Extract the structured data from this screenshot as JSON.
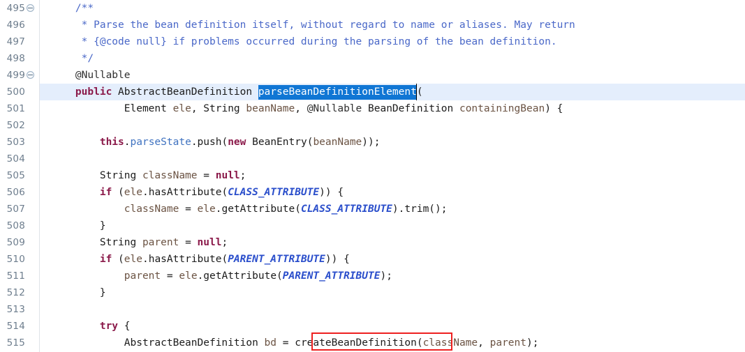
{
  "editor": {
    "kind": "java-source-editor",
    "current_line": 500,
    "selection_text": "parseBeanDefinitionElement",
    "annotation_box_text": "createBeanDefinition",
    "colors": {
      "background": "#ffffff",
      "current_line_highlight": "#e4eefc",
      "selection_background": "#1076d4",
      "selection_foreground": "#ffffff",
      "annotation_box_border": "#ee2020",
      "gutter_line_number": "#6d7d8d",
      "gutter_separator": "#dfe3e8",
      "keyword": "#8b1a4a",
      "javadoc": "#4a68c8",
      "field": "#3f72c0",
      "static_final_field": "#2a4ecb",
      "local_variable": "#6b5343",
      "plain_text": "#1b1b1b"
    }
  },
  "gutter": {
    "rows": [
      {
        "number": "495",
        "fold": true
      },
      {
        "number": "496",
        "fold": false
      },
      {
        "number": "497",
        "fold": false
      },
      {
        "number": "498",
        "fold": false
      },
      {
        "number": "499",
        "fold": true
      },
      {
        "number": "500",
        "fold": false
      },
      {
        "number": "501",
        "fold": false
      },
      {
        "number": "502",
        "fold": false
      },
      {
        "number": "503",
        "fold": false
      },
      {
        "number": "504",
        "fold": false
      },
      {
        "number": "505",
        "fold": false
      },
      {
        "number": "506",
        "fold": false
      },
      {
        "number": "507",
        "fold": false
      },
      {
        "number": "508",
        "fold": false
      },
      {
        "number": "509",
        "fold": false
      },
      {
        "number": "510",
        "fold": false
      },
      {
        "number": "511",
        "fold": false
      },
      {
        "number": "512",
        "fold": false
      },
      {
        "number": "513",
        "fold": false
      },
      {
        "number": "514",
        "fold": false
      },
      {
        "number": "515",
        "fold": false
      }
    ]
  },
  "code": {
    "lines": [
      {
        "number": "495",
        "plain": "    /**",
        "tokens": [
          {
            "t": "    /**",
            "c": "doc"
          }
        ]
      },
      {
        "number": "496",
        "plain": "     * Parse the bean definition itself, without regard to name or aliases. May return",
        "tokens": [
          {
            "t": "     * Parse the bean definition itself, without regard to name or aliases. May return",
            "c": "doc"
          }
        ]
      },
      {
        "number": "497",
        "plain": "     * {@code null} if problems occurred during the parsing of the bean definition.",
        "tokens": [
          {
            "t": "     * {@code null} if problems occurred during the parsing of the bean definition.",
            "c": "doc"
          }
        ]
      },
      {
        "number": "498",
        "plain": "     */",
        "tokens": [
          {
            "t": "     */",
            "c": "doc"
          }
        ]
      },
      {
        "number": "499",
        "plain": "    @Nullable",
        "tokens": [
          {
            "t": "    @Nullable",
            "c": "ann"
          }
        ]
      },
      {
        "number": "500",
        "plain": "    public AbstractBeanDefinition parseBeanDefinitionElement(",
        "tokens": [
          {
            "t": "    ",
            "c": "pl"
          },
          {
            "t": "public",
            "c": "kw"
          },
          {
            "t": " AbstractBeanDefinition ",
            "c": "pl"
          },
          {
            "t": "parseBeanDefinitionElement",
            "c": "sel"
          },
          {
            "t": "(",
            "c": "pl"
          }
        ]
      },
      {
        "number": "501",
        "plain": "            Element ele, String beanName, @Nullable BeanDefinition containingBean) {",
        "tokens": [
          {
            "t": "            Element ",
            "c": "pl"
          },
          {
            "t": "ele",
            "c": "lv"
          },
          {
            "t": ", String ",
            "c": "pl"
          },
          {
            "t": "beanName",
            "c": "lv"
          },
          {
            "t": ", ",
            "c": "pl"
          },
          {
            "t": "@Nullable",
            "c": "ann"
          },
          {
            "t": " BeanDefinition ",
            "c": "pl"
          },
          {
            "t": "containingBean",
            "c": "lv"
          },
          {
            "t": ") {",
            "c": "pl"
          }
        ]
      },
      {
        "number": "502",
        "plain": "",
        "tokens": []
      },
      {
        "number": "503",
        "plain": "        this.parseState.push(new BeanEntry(beanName));",
        "tokens": [
          {
            "t": "        ",
            "c": "pl"
          },
          {
            "t": "this",
            "c": "kw"
          },
          {
            "t": ".",
            "c": "pl"
          },
          {
            "t": "parseState",
            "c": "fld"
          },
          {
            "t": ".push(",
            "c": "pl"
          },
          {
            "t": "new",
            "c": "kw"
          },
          {
            "t": " BeanEntry(",
            "c": "pl"
          },
          {
            "t": "beanName",
            "c": "lv"
          },
          {
            "t": "));",
            "c": "pl"
          }
        ]
      },
      {
        "number": "504",
        "plain": "",
        "tokens": []
      },
      {
        "number": "505",
        "plain": "        String className = null;",
        "tokens": [
          {
            "t": "        String ",
            "c": "pl"
          },
          {
            "t": "className",
            "c": "lv"
          },
          {
            "t": " = ",
            "c": "pl"
          },
          {
            "t": "null",
            "c": "kw"
          },
          {
            "t": ";",
            "c": "pl"
          }
        ]
      },
      {
        "number": "506",
        "plain": "        if (ele.hasAttribute(CLASS_ATTRIBUTE)) {",
        "tokens": [
          {
            "t": "        ",
            "c": "pl"
          },
          {
            "t": "if",
            "c": "kw"
          },
          {
            "t": " (",
            "c": "pl"
          },
          {
            "t": "ele",
            "c": "lv"
          },
          {
            "t": ".hasAttribute(",
            "c": "pl"
          },
          {
            "t": "CLASS_ATTRIBUTE",
            "c": "sfld"
          },
          {
            "t": ")) {",
            "c": "pl"
          }
        ]
      },
      {
        "number": "507",
        "plain": "            className = ele.getAttribute(CLASS_ATTRIBUTE).trim();",
        "tokens": [
          {
            "t": "            ",
            "c": "pl"
          },
          {
            "t": "className",
            "c": "lv"
          },
          {
            "t": " = ",
            "c": "pl"
          },
          {
            "t": "ele",
            "c": "lv"
          },
          {
            "t": ".getAttribute(",
            "c": "pl"
          },
          {
            "t": "CLASS_ATTRIBUTE",
            "c": "sfld"
          },
          {
            "t": ").trim();",
            "c": "pl"
          }
        ]
      },
      {
        "number": "508",
        "plain": "        }",
        "tokens": [
          {
            "t": "        }",
            "c": "pl"
          }
        ]
      },
      {
        "number": "509",
        "plain": "        String parent = null;",
        "tokens": [
          {
            "t": "        String ",
            "c": "pl"
          },
          {
            "t": "parent",
            "c": "lv"
          },
          {
            "t": " = ",
            "c": "pl"
          },
          {
            "t": "null",
            "c": "kw"
          },
          {
            "t": ";",
            "c": "pl"
          }
        ]
      },
      {
        "number": "510",
        "plain": "        if (ele.hasAttribute(PARENT_ATTRIBUTE)) {",
        "tokens": [
          {
            "t": "        ",
            "c": "pl"
          },
          {
            "t": "if",
            "c": "kw"
          },
          {
            "t": " (",
            "c": "pl"
          },
          {
            "t": "ele",
            "c": "lv"
          },
          {
            "t": ".hasAttribute(",
            "c": "pl"
          },
          {
            "t": "PARENT_ATTRIBUTE",
            "c": "sfld"
          },
          {
            "t": ")) {",
            "c": "pl"
          }
        ]
      },
      {
        "number": "511",
        "plain": "            parent = ele.getAttribute(PARENT_ATTRIBUTE);",
        "tokens": [
          {
            "t": "            ",
            "c": "pl"
          },
          {
            "t": "parent",
            "c": "lv"
          },
          {
            "t": " = ",
            "c": "pl"
          },
          {
            "t": "ele",
            "c": "lv"
          },
          {
            "t": ".getAttribute(",
            "c": "pl"
          },
          {
            "t": "PARENT_ATTRIBUTE",
            "c": "sfld"
          },
          {
            "t": ");",
            "c": "pl"
          }
        ]
      },
      {
        "number": "512",
        "plain": "        }",
        "tokens": [
          {
            "t": "        }",
            "c": "pl"
          }
        ]
      },
      {
        "number": "513",
        "plain": "",
        "tokens": []
      },
      {
        "number": "514",
        "plain": "        try {",
        "tokens": [
          {
            "t": "        ",
            "c": "pl"
          },
          {
            "t": "try",
            "c": "kw"
          },
          {
            "t": " {",
            "c": "pl"
          }
        ]
      },
      {
        "number": "515",
        "plain": "            AbstractBeanDefinition bd = createBeanDefinition(className, parent);",
        "tokens": [
          {
            "t": "            AbstractBeanDefinition ",
            "c": "pl"
          },
          {
            "t": "bd",
            "c": "lv"
          },
          {
            "t": " = ",
            "c": "pl"
          },
          {
            "t": "createBeanDefinition",
            "c": "pl"
          },
          {
            "t": "(",
            "c": "pl"
          },
          {
            "t": "className",
            "c": "lv"
          },
          {
            "t": ", ",
            "c": "pl"
          },
          {
            "t": "parent",
            "c": "lv"
          },
          {
            "t": ");",
            "c": "pl"
          }
        ]
      }
    ]
  }
}
